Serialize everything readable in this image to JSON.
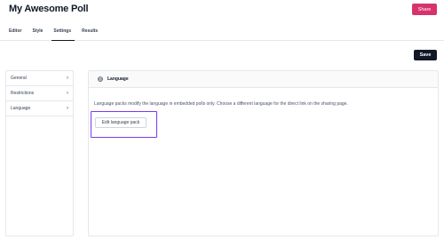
{
  "header": {
    "title": "My Awesome Poll",
    "share_label": "Share",
    "share_color": "#d6336c"
  },
  "tabs": [
    {
      "label": "Editor",
      "active": false
    },
    {
      "label": "Style",
      "active": false
    },
    {
      "label": "Settings",
      "active": true
    },
    {
      "label": "Results",
      "active": false
    }
  ],
  "toolbar": {
    "save_label": "Save"
  },
  "sidebar": {
    "items": [
      {
        "label": "General",
        "icon": "chevron-right-icon"
      },
      {
        "label": "Restrictions",
        "icon": "chevron-right-icon"
      },
      {
        "label": "Language",
        "icon": "chevron-right-icon"
      }
    ]
  },
  "language_panel": {
    "heading": "Language",
    "heading_icon": "globe-icon",
    "description": "Language packs modify the language in embedded polls only. Choose a different language for the direct link on the sharing page.",
    "edit_button_label": "Edit language pack",
    "highlight_color": "#7c3aed"
  }
}
